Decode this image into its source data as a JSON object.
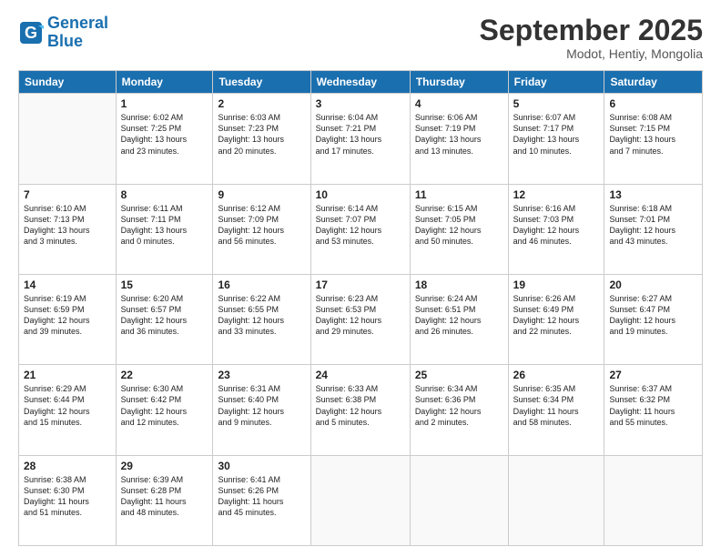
{
  "header": {
    "logo_line1": "General",
    "logo_line2": "Blue",
    "title": "September 2025",
    "subtitle": "Modot, Hentiy, Mongolia"
  },
  "days_of_week": [
    "Sunday",
    "Monday",
    "Tuesday",
    "Wednesday",
    "Thursday",
    "Friday",
    "Saturday"
  ],
  "weeks": [
    [
      {
        "num": "",
        "info": ""
      },
      {
        "num": "1",
        "info": "Sunrise: 6:02 AM\nSunset: 7:25 PM\nDaylight: 13 hours\nand 23 minutes."
      },
      {
        "num": "2",
        "info": "Sunrise: 6:03 AM\nSunset: 7:23 PM\nDaylight: 13 hours\nand 20 minutes."
      },
      {
        "num": "3",
        "info": "Sunrise: 6:04 AM\nSunset: 7:21 PM\nDaylight: 13 hours\nand 17 minutes."
      },
      {
        "num": "4",
        "info": "Sunrise: 6:06 AM\nSunset: 7:19 PM\nDaylight: 13 hours\nand 13 minutes."
      },
      {
        "num": "5",
        "info": "Sunrise: 6:07 AM\nSunset: 7:17 PM\nDaylight: 13 hours\nand 10 minutes."
      },
      {
        "num": "6",
        "info": "Sunrise: 6:08 AM\nSunset: 7:15 PM\nDaylight: 13 hours\nand 7 minutes."
      }
    ],
    [
      {
        "num": "7",
        "info": "Sunrise: 6:10 AM\nSunset: 7:13 PM\nDaylight: 13 hours\nand 3 minutes."
      },
      {
        "num": "8",
        "info": "Sunrise: 6:11 AM\nSunset: 7:11 PM\nDaylight: 13 hours\nand 0 minutes."
      },
      {
        "num": "9",
        "info": "Sunrise: 6:12 AM\nSunset: 7:09 PM\nDaylight: 12 hours\nand 56 minutes."
      },
      {
        "num": "10",
        "info": "Sunrise: 6:14 AM\nSunset: 7:07 PM\nDaylight: 12 hours\nand 53 minutes."
      },
      {
        "num": "11",
        "info": "Sunrise: 6:15 AM\nSunset: 7:05 PM\nDaylight: 12 hours\nand 50 minutes."
      },
      {
        "num": "12",
        "info": "Sunrise: 6:16 AM\nSunset: 7:03 PM\nDaylight: 12 hours\nand 46 minutes."
      },
      {
        "num": "13",
        "info": "Sunrise: 6:18 AM\nSunset: 7:01 PM\nDaylight: 12 hours\nand 43 minutes."
      }
    ],
    [
      {
        "num": "14",
        "info": "Sunrise: 6:19 AM\nSunset: 6:59 PM\nDaylight: 12 hours\nand 39 minutes."
      },
      {
        "num": "15",
        "info": "Sunrise: 6:20 AM\nSunset: 6:57 PM\nDaylight: 12 hours\nand 36 minutes."
      },
      {
        "num": "16",
        "info": "Sunrise: 6:22 AM\nSunset: 6:55 PM\nDaylight: 12 hours\nand 33 minutes."
      },
      {
        "num": "17",
        "info": "Sunrise: 6:23 AM\nSunset: 6:53 PM\nDaylight: 12 hours\nand 29 minutes."
      },
      {
        "num": "18",
        "info": "Sunrise: 6:24 AM\nSunset: 6:51 PM\nDaylight: 12 hours\nand 26 minutes."
      },
      {
        "num": "19",
        "info": "Sunrise: 6:26 AM\nSunset: 6:49 PM\nDaylight: 12 hours\nand 22 minutes."
      },
      {
        "num": "20",
        "info": "Sunrise: 6:27 AM\nSunset: 6:47 PM\nDaylight: 12 hours\nand 19 minutes."
      }
    ],
    [
      {
        "num": "21",
        "info": "Sunrise: 6:29 AM\nSunset: 6:44 PM\nDaylight: 12 hours\nand 15 minutes."
      },
      {
        "num": "22",
        "info": "Sunrise: 6:30 AM\nSunset: 6:42 PM\nDaylight: 12 hours\nand 12 minutes."
      },
      {
        "num": "23",
        "info": "Sunrise: 6:31 AM\nSunset: 6:40 PM\nDaylight: 12 hours\nand 9 minutes."
      },
      {
        "num": "24",
        "info": "Sunrise: 6:33 AM\nSunset: 6:38 PM\nDaylight: 12 hours\nand 5 minutes."
      },
      {
        "num": "25",
        "info": "Sunrise: 6:34 AM\nSunset: 6:36 PM\nDaylight: 12 hours\nand 2 minutes."
      },
      {
        "num": "26",
        "info": "Sunrise: 6:35 AM\nSunset: 6:34 PM\nDaylight: 11 hours\nand 58 minutes."
      },
      {
        "num": "27",
        "info": "Sunrise: 6:37 AM\nSunset: 6:32 PM\nDaylight: 11 hours\nand 55 minutes."
      }
    ],
    [
      {
        "num": "28",
        "info": "Sunrise: 6:38 AM\nSunset: 6:30 PM\nDaylight: 11 hours\nand 51 minutes."
      },
      {
        "num": "29",
        "info": "Sunrise: 6:39 AM\nSunset: 6:28 PM\nDaylight: 11 hours\nand 48 minutes."
      },
      {
        "num": "30",
        "info": "Sunrise: 6:41 AM\nSunset: 6:26 PM\nDaylight: 11 hours\nand 45 minutes."
      },
      {
        "num": "",
        "info": ""
      },
      {
        "num": "",
        "info": ""
      },
      {
        "num": "",
        "info": ""
      },
      {
        "num": "",
        "info": ""
      }
    ]
  ]
}
